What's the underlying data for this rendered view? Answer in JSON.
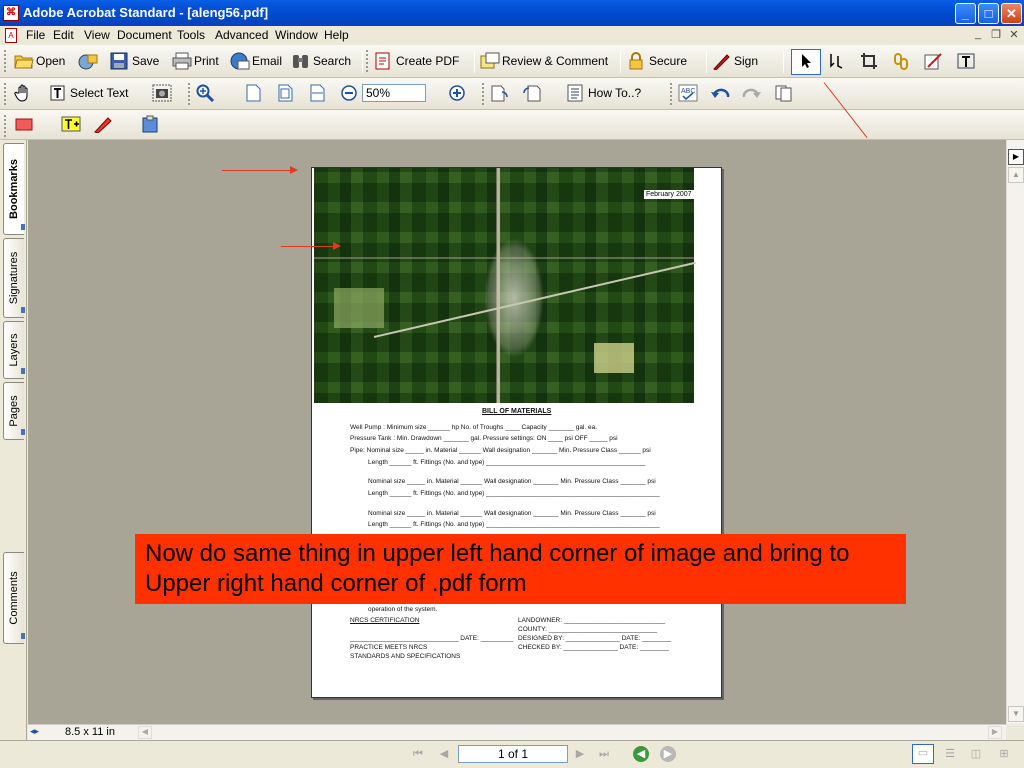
{
  "window": {
    "title": "Adobe Acrobat Standard - [aleng56.pdf]",
    "min": "_",
    "max": "□",
    "close": "✕"
  },
  "menu": [
    "File",
    "Edit",
    "View",
    "Document",
    "Tools",
    "Advanced",
    "Window",
    "Help"
  ],
  "toolbar1": {
    "open": "Open",
    "save": "Save",
    "print": "Print",
    "email": "Email",
    "search": "Search",
    "create_pdf": "Create PDF",
    "review": "Review & Comment",
    "secure": "Secure",
    "sign": "Sign"
  },
  "toolbar2": {
    "select_text": "Select Text",
    "zoom": "50%",
    "how_to": "How To..?"
  },
  "side_tabs": {
    "bookmarks": "Bookmarks",
    "signatures": "Signatures",
    "layers": "Layers",
    "pages": "Pages",
    "comments": "Comments"
  },
  "pdf": {
    "date": "February 2007",
    "heading": "BILL OF MATERIALS",
    "lines": [
      "Well Pump  :  Minimum size ______ hp        No. of Troughs ____         Capacity _______ gal. ea.",
      "Pressure Tank  :  Min. Drawdown _______ gal.                Pressure settings:  ON ____ psi      OFF _____ psi",
      "Pipe:  Nominal size  _____ in.     Material ______       Wall designation _______      Min. Pressure Class ______ psi",
      "Length ______ ft.         Fittings (No. and type) ____________________________________________",
      "Nominal size  _____ in.    Material ______       Wall designation _______     Min. Pressure Class _______ psi",
      "Length ______ ft.      Fittings (No. and type) ________________________________________________",
      "Nominal size  _____ in.     Material ______       Wall designation _______     Min. Pressure Class _______ psi",
      "Length ______ ft.      Fittings (No. and type) ________________________________________________"
    ],
    "footer": [
      "operation of the system.",
      "NRCS CERTIFICATION",
      "______________________________ DATE: _________",
      "PRACTICE MEETS NRCS",
      "STANDARDS AND SPECIFICATIONS",
      "LANDOWNER: ____________________________",
      "COUNTY: ______________________________",
      "DESIGNED BY: _______________  DATE: ________",
      "CHECKED BY: _______________ DATE: ________"
    ]
  },
  "annotation": {
    "text": "Now do same thing in upper left hand corner of image and bring to Upper right hand corner of .pdf form",
    "color": "#ff3100"
  },
  "status": {
    "page_size": "8.5 x 11 in",
    "page": "1 of 1"
  }
}
